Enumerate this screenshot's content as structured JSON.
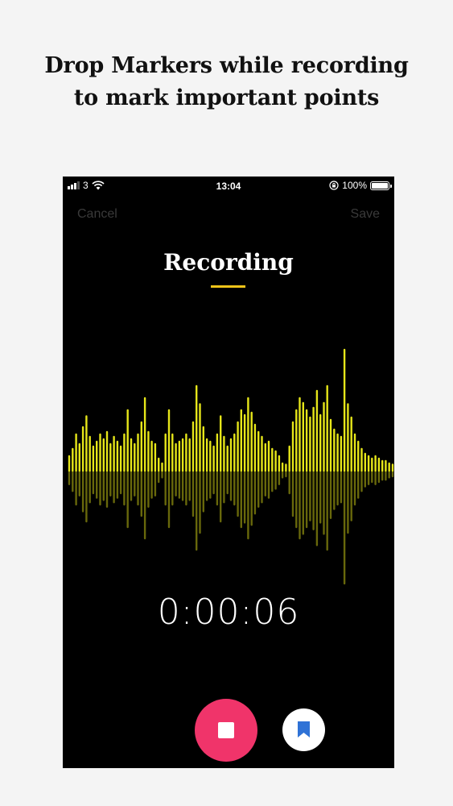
{
  "headline": {
    "line1": "Drop Markers while recording",
    "line2": "to mark important points"
  },
  "status_bar": {
    "carrier": "3",
    "time": "13:04",
    "battery": "100%",
    "signal_bars": 4,
    "signal_active": 3,
    "icons": [
      "signal-icon",
      "wifi-icon",
      "orientation-lock-icon",
      "battery-icon"
    ]
  },
  "nav": {
    "cancel_label": "Cancel",
    "save_label": "Save"
  },
  "title": "Recording",
  "timer": "0:00:06",
  "waveform": {
    "color": "#e6e619",
    "levels": [
      0.12,
      0.18,
      0.3,
      0.22,
      0.36,
      0.45,
      0.28,
      0.2,
      0.24,
      0.3,
      0.26,
      0.32,
      0.22,
      0.28,
      0.24,
      0.2,
      0.3,
      0.5,
      0.26,
      0.22,
      0.3,
      0.4,
      0.6,
      0.32,
      0.24,
      0.22,
      0.1,
      0.06,
      0.3,
      0.5,
      0.3,
      0.22,
      0.24,
      0.26,
      0.3,
      0.26,
      0.4,
      0.7,
      0.55,
      0.36,
      0.26,
      0.24,
      0.2,
      0.3,
      0.45,
      0.28,
      0.2,
      0.26,
      0.3,
      0.4,
      0.5,
      0.46,
      0.6,
      0.48,
      0.38,
      0.32,
      0.28,
      0.22,
      0.24,
      0.18,
      0.16,
      0.12,
      0.06,
      0.05,
      0.2,
      0.4,
      0.5,
      0.6,
      0.56,
      0.5,
      0.44,
      0.52,
      0.66,
      0.46,
      0.56,
      0.7,
      0.42,
      0.34,
      0.3,
      0.28,
      1.0,
      0.55,
      0.44,
      0.3,
      0.24,
      0.18,
      0.14,
      0.12,
      0.1,
      0.12,
      0.1,
      0.08,
      0.08,
      0.06,
      0.05
    ],
    "bright_until": 0.66
  },
  "colors": {
    "background": "#f4f4f4",
    "phone_background": "#000000",
    "accent_underline": "#f0c419",
    "stop_button": "#f0346a",
    "bookmark": "#2f72d6"
  }
}
